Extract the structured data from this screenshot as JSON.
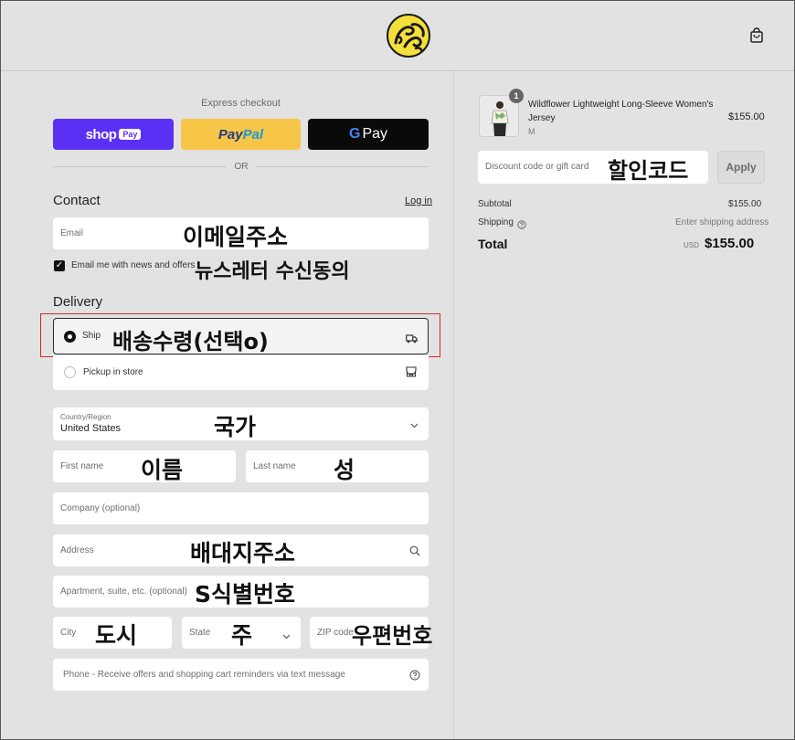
{
  "header": {
    "logo": "store-logo",
    "cart_icon": "shopping-bag-icon"
  },
  "express": {
    "title": "Express checkout",
    "shop_label": "shop",
    "shop_badge": "Pay",
    "paypal_a": "Pay",
    "paypal_b": "Pal",
    "gpay_g": "G",
    "gpay_text": "Pay",
    "or": "OR"
  },
  "contact": {
    "title": "Contact",
    "login": "Log in",
    "email_placeholder": "Email",
    "email_note": "이메일주소",
    "newsletter_label": "Email me with news and offers",
    "newsletter_checked": true,
    "newsletter_note": "뉴스레터 수신동의"
  },
  "delivery": {
    "title": "Delivery",
    "ship_label": "Ship",
    "ship_note": "배송수령(선택o)",
    "pickup_label": "Pickup in store",
    "country_label": "Country/Region",
    "country_value": "United States",
    "country_note": "국가",
    "first_name_placeholder": "First name",
    "first_name_note": "이름",
    "last_name_placeholder": "Last name",
    "last_name_note": "성",
    "company_placeholder": "Company (optional)",
    "address_placeholder": "Address",
    "address_note": "배대지주소",
    "apartment_placeholder": "Apartment, suite, etc. (optional)",
    "apartment_note": "S식별번호",
    "city_placeholder": "City",
    "city_note": "도시",
    "state_placeholder": "State",
    "state_note": "주",
    "zip_placeholder": "ZIP code",
    "zip_note": "우편번호",
    "phone_placeholder": "Phone - Receive offers and shopping cart reminders via text message"
  },
  "summary": {
    "item_qty": "1",
    "item_name_line1": "Wildflower Lightweight Long-Sleeve Women's",
    "item_name_line2": "Jersey",
    "item_variant": "M",
    "item_price": "$155.00",
    "discount_placeholder": "Discount code or gift card",
    "discount_note": "할인코드",
    "apply": "Apply",
    "subtotal_label": "Subtotal",
    "subtotal_value": "$155.00",
    "shipping_label": "Shipping",
    "shipping_value": "Enter shipping address",
    "total_label": "Total",
    "total_currency": "USD",
    "total_value": "$155.00"
  },
  "colors": {
    "shop_pay": "#5a31f4",
    "paypal": "#f7c548",
    "annotation_red": "#d02b2b"
  }
}
